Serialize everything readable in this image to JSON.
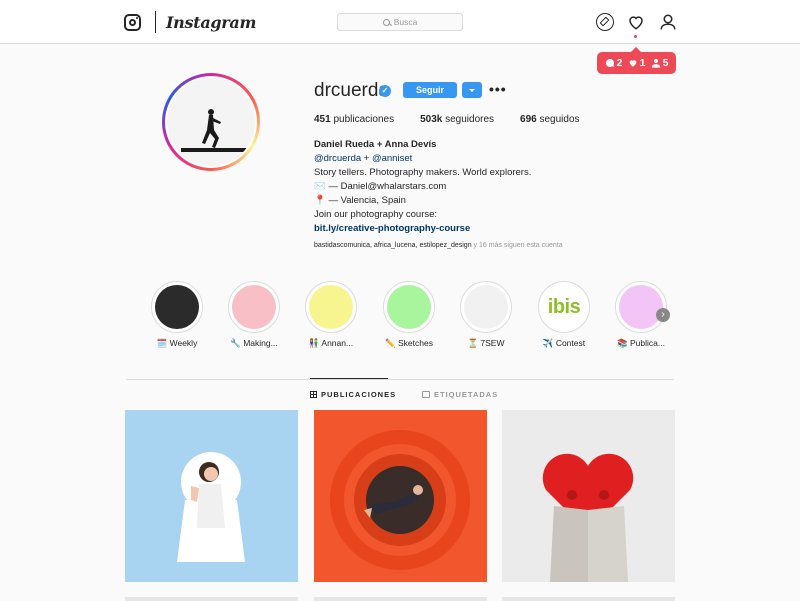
{
  "nav": {
    "logo_text": "Instagram",
    "search_placeholder": "Busca"
  },
  "notifications": {
    "comments": "2",
    "likes": "1",
    "follows": "5"
  },
  "profile": {
    "username": "drcuerda",
    "verified_mark": "✓",
    "follow_label": "Seguir",
    "more_label": "•••",
    "stats": {
      "posts_value": "451",
      "posts_label": "publicaciones",
      "followers_value": "503k",
      "followers_label": "seguidores",
      "following_value": "696",
      "following_label": "seguidos"
    },
    "bio": {
      "name": "Daniel Rueda + Anna Devís",
      "mention1": "@drcuerda",
      "plus": " + ",
      "mention2": "@anniset",
      "line1": "Story tellers. Photography makers. World explorers.",
      "line2": "✉️ — Daniel@whalarstars.com",
      "line3": "📍 — Valencia, Spain",
      "line4": "Join our photography course:",
      "url": "bit.ly/creative-photography-course"
    },
    "followed_by": "bastidascomunica, africa_lucena, estilopez_design",
    "followed_more": " y 16 más siguen esta cuenta"
  },
  "highlights": [
    {
      "label": "🗓️ Weekly",
      "color": "#2b2b2b"
    },
    {
      "label": "🔧 Making...",
      "color": "#f9bfc6"
    },
    {
      "label": "👫 Annan...",
      "color": "#f7f590"
    },
    {
      "label": "✏️ Sketches",
      "color": "#a9f59e"
    },
    {
      "label": "⏳ 7SEW",
      "color": "#f1f1f1"
    },
    {
      "label": "✈️ Contest",
      "color": "#ffffff",
      "logo": "ibis"
    },
    {
      "label": "📚 Publica...",
      "color": "#f3c5f7"
    }
  ],
  "tabs": {
    "posts": "PUBLICACIONES",
    "tagged": "ETIQUETADAS"
  },
  "colors": {
    "accent": "#3897f0",
    "notification": "#ed4956",
    "link": "#003569"
  }
}
